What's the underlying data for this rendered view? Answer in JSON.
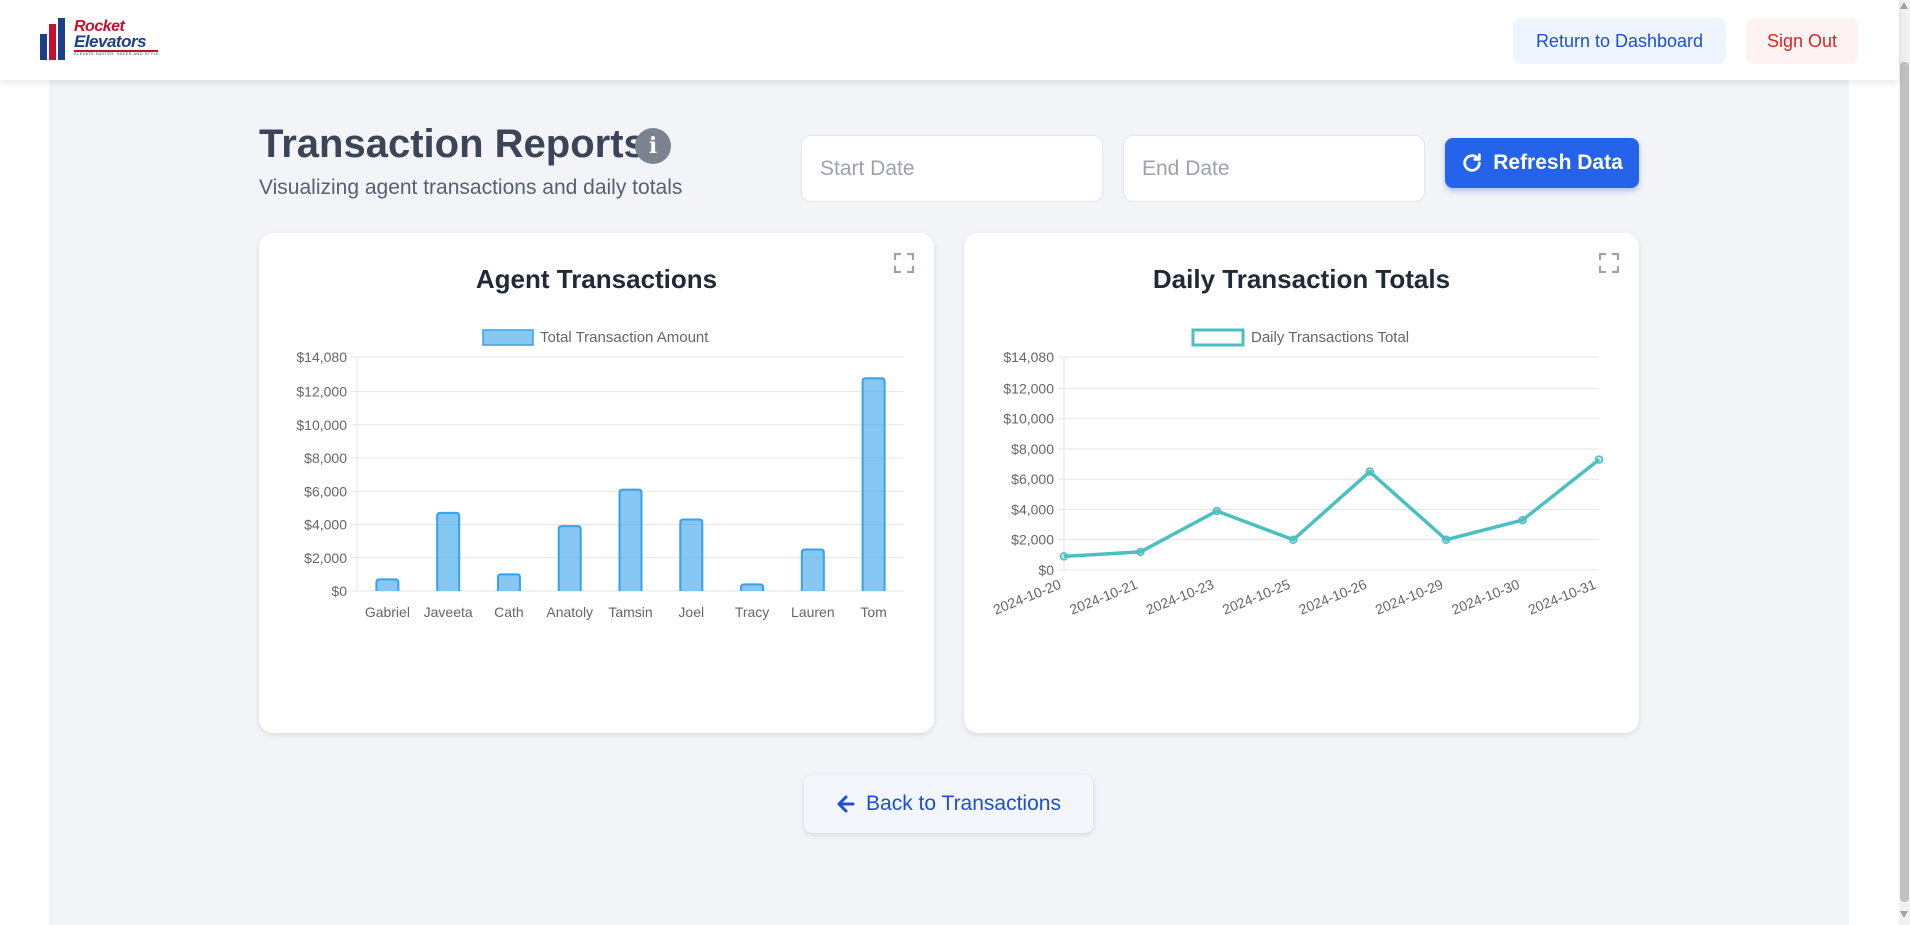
{
  "app": {
    "logo_text_1": "Rocket",
    "logo_text_2": "Elevators",
    "logo_tagline": "ELEVATE FASTER, SAFER AND STYLE"
  },
  "nav": {
    "return_label": "Return to Dashboard",
    "signout_label": "Sign Out"
  },
  "header": {
    "title": "Transaction Reports",
    "subtitle": "Visualizing agent transactions and daily totals",
    "info_icon": "info-circle-icon"
  },
  "filters": {
    "start_placeholder": "Start Date",
    "end_placeholder": "End Date",
    "start_value": "",
    "end_value": "",
    "refresh_label": "Refresh Data",
    "refresh_icon": "refresh-icon"
  },
  "footer": {
    "back_label": "Back to Transactions",
    "back_icon": "arrow-left-icon"
  },
  "colors": {
    "primary": "#2563eb",
    "bar_fill": "rgba(54,162,235,0.6)",
    "bar_border": "#36a2eb",
    "line": "#4bc0c0",
    "danger": "#dc2626"
  },
  "chart_data": [
    {
      "type": "bar",
      "title": "Agent Transactions",
      "categories": [
        "Gabriel",
        "Javeeta",
        "Cath",
        "Anatoly",
        "Tamsin",
        "Joel",
        "Tracy",
        "Lauren",
        "Tom"
      ],
      "series": [
        {
          "name": "Total Transaction Amount",
          "values": [
            700,
            4700,
            1000,
            3900,
            6100,
            4300,
            400,
            2500,
            12800
          ]
        }
      ],
      "ylim": [
        0,
        14080
      ],
      "yticks": [
        "$14,080",
        "$12,000",
        "$10,000",
        "$8,000",
        "$6,000",
        "$4,000",
        "$2,000",
        "$0"
      ],
      "ytick_values": [
        14080,
        12000,
        10000,
        8000,
        6000,
        4000,
        2000,
        0
      ],
      "grid": true,
      "legend": "top-center"
    },
    {
      "type": "line",
      "title": "Daily Transaction Totals",
      "categories": [
        "2024-10-20",
        "2024-10-21",
        "2024-10-23",
        "2024-10-25",
        "2024-10-26",
        "2024-10-29",
        "2024-10-30",
        "2024-10-31"
      ],
      "series": [
        {
          "name": "Daily Transactions Total",
          "values": [
            900,
            1200,
            3900,
            2000,
            6500,
            2000,
            3300,
            7300
          ]
        }
      ],
      "ylim": [
        0,
        14080
      ],
      "yticks": [
        "$14,080",
        "$12,000",
        "$10,000",
        "$8,000",
        "$6,000",
        "$4,000",
        "$2,000",
        "$0"
      ],
      "ytick_values": [
        14080,
        12000,
        10000,
        8000,
        6000,
        4000,
        2000,
        0
      ],
      "grid": true,
      "legend": "top-center"
    }
  ]
}
